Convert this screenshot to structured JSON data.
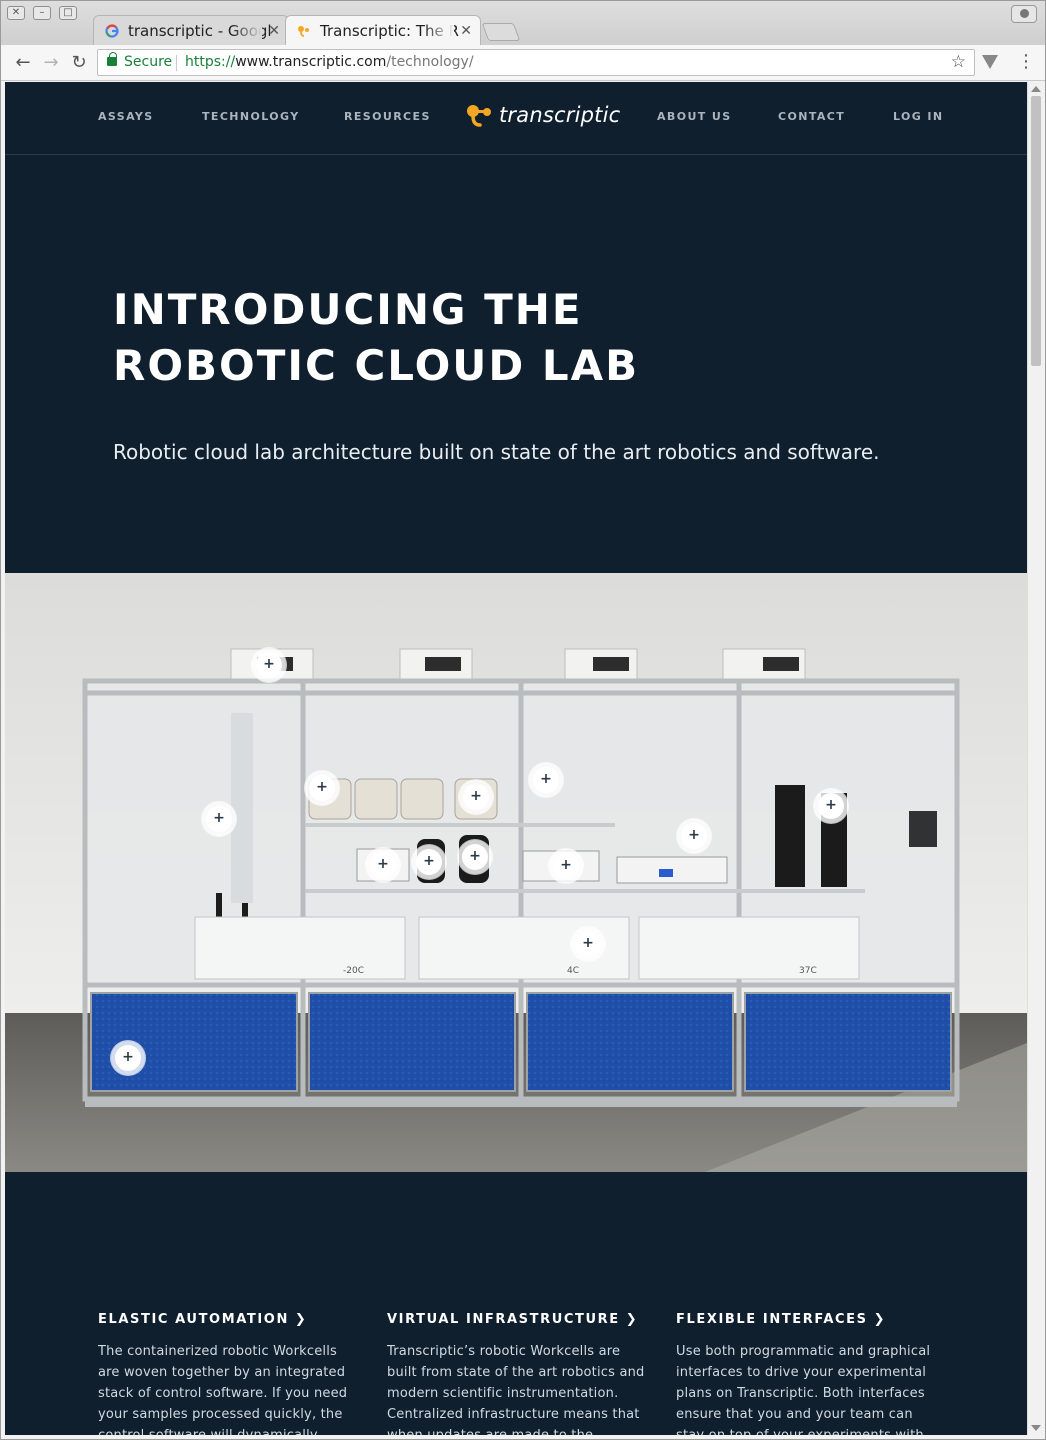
{
  "browser": {
    "tabs": [
      {
        "title": "transcriptic - Googl",
        "active": false,
        "favicon": "google-icon"
      },
      {
        "title": "Transcriptic: The R",
        "active": true,
        "favicon": "transcriptic-icon"
      }
    ],
    "address_bar": {
      "security_label": "Secure",
      "scheme": "https://",
      "host": "www.transcriptic.com",
      "path": "/technology/"
    }
  },
  "site": {
    "nav": {
      "assays": "ASSAYS",
      "technology": "TECHNOLOGY",
      "resources": "RESOURCES",
      "logo_text": "transcriptic",
      "about": "ABOUT US",
      "contact": "CONTACT",
      "login": "LOG IN"
    },
    "hero": {
      "title_line1": "INTRODUCING THE",
      "title_line2": "ROBOTIC CLOUD LAB",
      "subtitle": "Robotic cloud lab architecture built on state of the art robotics and software."
    },
    "lab_labels": {
      "freezer": "-20C",
      "fridge": "4C",
      "incubator": "37C"
    },
    "features": [
      {
        "title": "ELASTIC AUTOMATION",
        "text": "The containerized robotic Workcells are woven together by an integrated stack of control software. If you need your samples processed quickly, the control software will dynamically provision"
      },
      {
        "title": "VIRTUAL INFRASTRUCTURE",
        "text": "Transcriptic’s robotic Workcells are built from state of the art robotics and modern scientific instrumentation. Centralized infrastructure means that when updates are made to the platform"
      },
      {
        "title": "FLEXIBLE INTERFACES",
        "text": "Use both programmatic and graphical interfaces to drive your experimental plans on Transcriptic. Both interfaces ensure that you and your team can stay on top of your experiments with access"
      }
    ]
  },
  "colors": {
    "page_bg": "#0f1f2d",
    "logo_orange": "#f5a623",
    "secure_green": "#188038",
    "panel_blue": "#1f4fa8"
  }
}
